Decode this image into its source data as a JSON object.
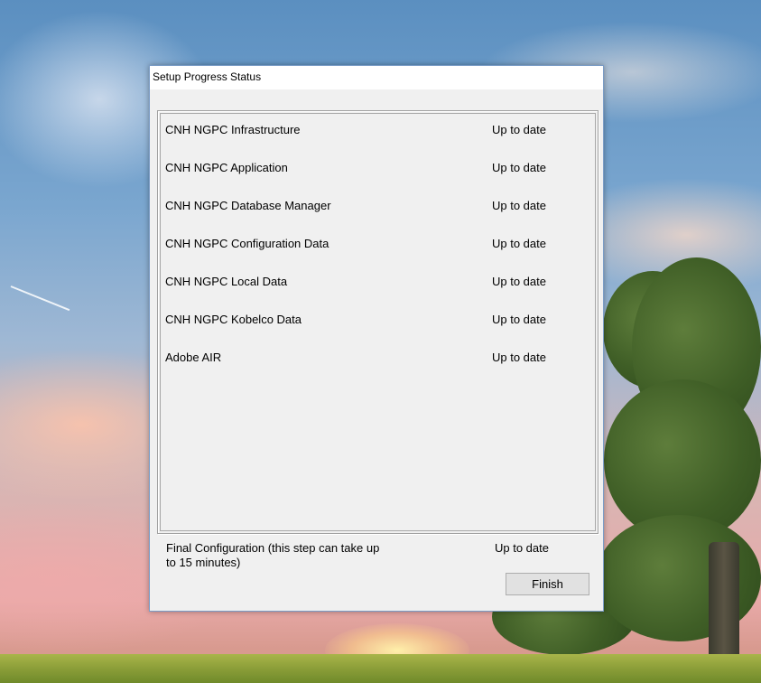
{
  "window": {
    "title": "Setup Progress Status"
  },
  "components": [
    {
      "name": "CNH NGPC Infrastructure",
      "status": "Up to date"
    },
    {
      "name": "CNH NGPC Application",
      "status": "Up to date"
    },
    {
      "name": "CNH NGPC Database Manager",
      "status": "Up to date"
    },
    {
      "name": "CNH NGPC Configuration Data",
      "status": "Up to date"
    },
    {
      "name": "CNH NGPC Local Data",
      "status": "Up to date"
    },
    {
      "name": "CNH NGPC Kobelco Data",
      "status": "Up to date"
    },
    {
      "name": "Adobe AIR",
      "status": "Up to date"
    }
  ],
  "final_step": {
    "label": "Final Configuration (this step can take up to 15 minutes)",
    "status": "Up to date"
  },
  "buttons": {
    "finish_label": "Finish"
  },
  "colors": {
    "dialog_background": "#f0f0f0",
    "window_border": "#7a9cc6",
    "button_face": "#e1e1e1"
  }
}
